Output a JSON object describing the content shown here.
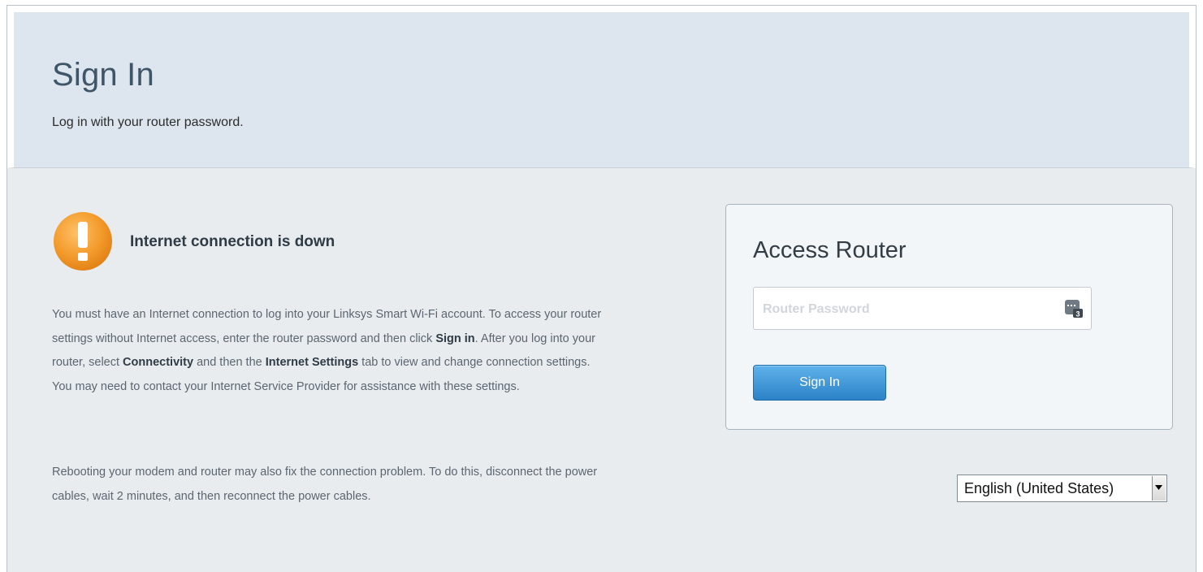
{
  "header": {
    "title": "Sign In",
    "subtitle": "Log in with your router password."
  },
  "warning": {
    "icon": "exclamation-icon",
    "title": "Internet connection is down",
    "color": "#f39a2b",
    "paragraph1": [
      {
        "t": "You must have an Internet connection to log into your Linksys Smart Wi-Fi account. To access your router settings without Internet access, enter the router password and then click ",
        "b": false
      },
      {
        "t": "Sign in",
        "b": true
      },
      {
        "t": ". After you log into your router, select ",
        "b": false
      },
      {
        "t": "Connectivity",
        "b": true
      },
      {
        "t": " and then the ",
        "b": false
      },
      {
        "t": "Internet Settings",
        "b": true
      },
      {
        "t": " tab to view and change connection settings. You may need to contact your Internet Service Provider for assistance with these settings.",
        "b": false
      }
    ],
    "paragraph2": "Rebooting your modem and router may also fix the connection problem. To do this, disconnect the power cables, wait 2 minutes, and then reconnect the power cables."
  },
  "access_card": {
    "title": "Access Router",
    "password_placeholder": "Router Password",
    "password_value": "",
    "keypad_icon": "keypad-icon",
    "keypad_number": "3",
    "signin_label": "Sign In",
    "button_color": "#2b82c7"
  },
  "language": {
    "selected": "English (United States)"
  }
}
